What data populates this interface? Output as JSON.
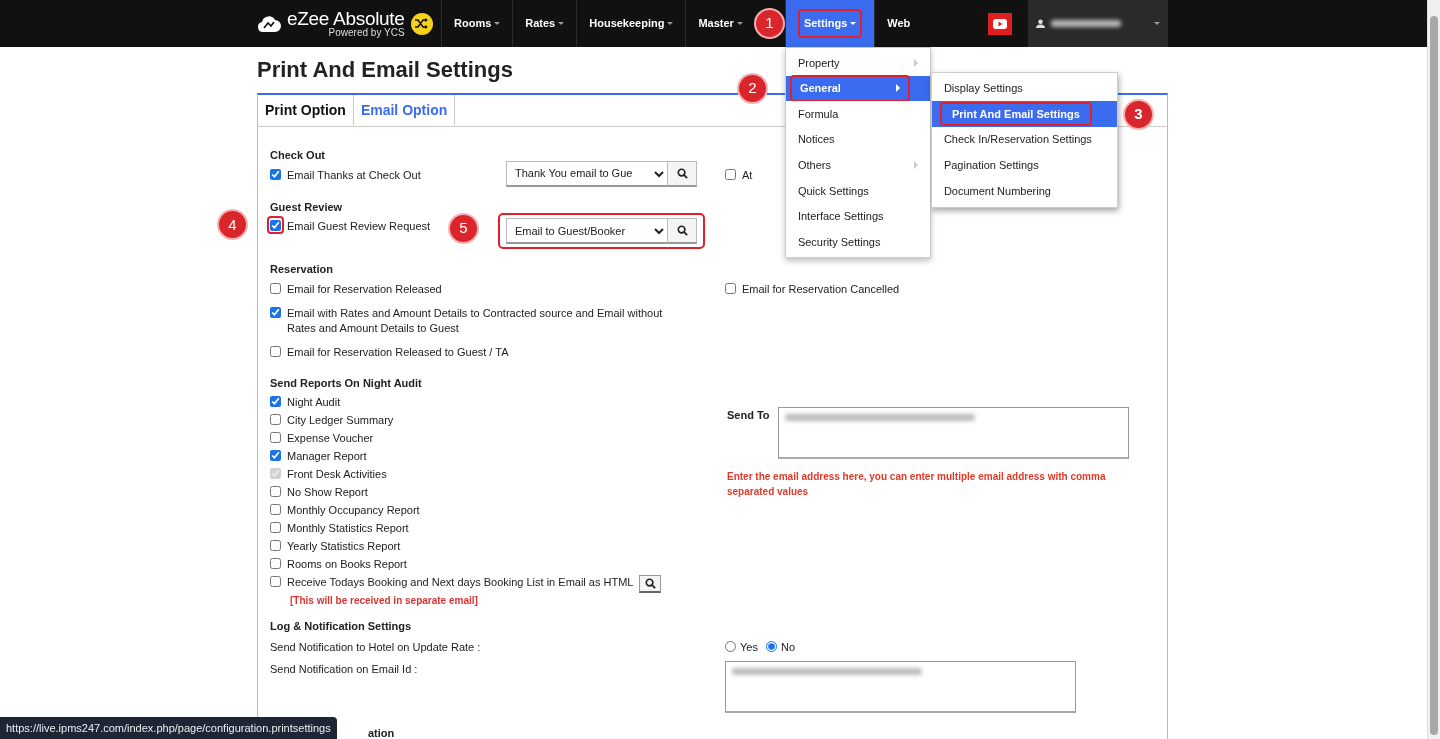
{
  "navbar": {
    "brand": "eZee Absolute",
    "tagline": "Powered by YCS",
    "items": [
      {
        "label": "Rooms",
        "dropdown": true,
        "selected": false
      },
      {
        "label": "Rates",
        "dropdown": true,
        "selected": false
      },
      {
        "label": "Housekeeping",
        "dropdown": true,
        "selected": false
      },
      {
        "label": "Master",
        "dropdown": true,
        "selected": false
      },
      {
        "label": "Settings",
        "dropdown": true,
        "selected": true,
        "step": "1"
      },
      {
        "label": "Web",
        "dropdown": false,
        "selected": false
      }
    ],
    "user": {
      "redacted": true
    }
  },
  "settings_menu": {
    "items": [
      {
        "label": "Property",
        "submenu": true,
        "selected": false
      },
      {
        "label": "General",
        "submenu": true,
        "selected": true,
        "step": "2"
      },
      {
        "label": "Formula",
        "submenu": false,
        "selected": false
      },
      {
        "label": "Notices",
        "submenu": false,
        "selected": false
      },
      {
        "label": "Others",
        "submenu": true,
        "selected": false
      },
      {
        "label": "Quick Settings",
        "submenu": false,
        "selected": false
      },
      {
        "label": "Interface Settings",
        "submenu": false,
        "selected": false
      },
      {
        "label": "Security Settings",
        "submenu": false,
        "selected": false
      }
    ],
    "submenu": [
      {
        "label": "Display Settings",
        "selected": false
      },
      {
        "label": "Print And Email Settings",
        "selected": true,
        "step": "3"
      },
      {
        "label": "Check In/Reservation Settings",
        "selected": false
      },
      {
        "label": "Pagination Settings",
        "selected": false
      },
      {
        "label": "Document Numbering",
        "selected": false
      }
    ]
  },
  "page_title": "Print And Email Settings",
  "tabs": [
    {
      "label": "Print Option",
      "selected": true
    },
    {
      "label": "Email Option",
      "selected": false
    }
  ],
  "sections": [
    {
      "title": "Check Out",
      "rows": [
        {
          "kind": "template",
          "label": "Email Thanks at Check Out",
          "checked": true,
          "template": "Thank You email to Gue",
          "right": {
            "label": "At",
            "checked": false
          }
        }
      ]
    },
    {
      "title": "Guest Review",
      "rows": [
        {
          "kind": "template",
          "label": "Email Guest Review Request",
          "checked": true,
          "template": "Email to Guest/Booker",
          "checkbox_step": "4",
          "template_step": "5"
        }
      ]
    },
    {
      "title": "Reservation",
      "rows": [
        {
          "kind": "checkbox",
          "label": "Email for Reservation Released",
          "checked": false,
          "right": {
            "label": "Email for Reservation Cancelled",
            "checked": false
          }
        },
        {
          "kind": "checkbox",
          "label": "Email with Rates and Amount Details to Contracted source and Email without Rates and Amount Details to Guest",
          "checked": true
        },
        {
          "kind": "checkbox",
          "label": "Email for Reservation Released to Guest / TA",
          "checked": false
        }
      ]
    },
    {
      "title": "Send Reports On Night Audit",
      "kind": "reports",
      "items": [
        {
          "kind": "checkbox",
          "label": "Night Audit",
          "checked": true,
          "disabled": false
        },
        {
          "kind": "checkbox",
          "label": "City Ledger Summary",
          "checked": false,
          "disabled": false
        },
        {
          "kind": "checkbox",
          "label": "Expense Voucher",
          "checked": false,
          "disabled": false
        },
        {
          "kind": "checkbox",
          "label": "Manager Report",
          "checked": true,
          "disabled": false
        },
        {
          "kind": "checkbox",
          "label": "Front Desk Activities",
          "checked": true,
          "disabled": true
        },
        {
          "kind": "checkbox",
          "label": "No Show Report",
          "checked": false,
          "disabled": false
        },
        {
          "kind": "checkbox",
          "label": "Monthly Occupancy Report",
          "checked": false,
          "disabled": false
        },
        {
          "kind": "checkbox",
          "label": "Monthly Statistics Report",
          "checked": false,
          "disabled": false
        },
        {
          "kind": "checkbox",
          "label": "Yearly Statistics Report",
          "checked": false,
          "disabled": false
        },
        {
          "kind": "checkbox",
          "label": "Rooms on Books Report",
          "checked": false,
          "disabled": false
        },
        {
          "kind": "lookup",
          "label": "Receive Todays Booking and Next days Booking List in Email as HTML",
          "checked": false,
          "disabled": false,
          "note": "[This will be received in separate email]"
        }
      ],
      "side": {
        "label": "Send To",
        "redacted": true,
        "hint": "Enter the email address here, you can enter multiple email address with comma separated values"
      }
    },
    {
      "title": "Log & Notification Settings",
      "rows": [
        {
          "kind": "radio",
          "label": "Send Notification to Hotel on Update Rate :",
          "options": [
            {
              "label": "Yes",
              "selected": false
            },
            {
              "label": "No",
              "selected": true
            }
          ]
        },
        {
          "kind": "email_box",
          "label": "Send Notification on Email Id :",
          "redacted": true
        }
      ]
    }
  ],
  "cut_heading": "ation",
  "status_url": "https://live.ipms247.com/index.php/page/configuration.printsettings"
}
